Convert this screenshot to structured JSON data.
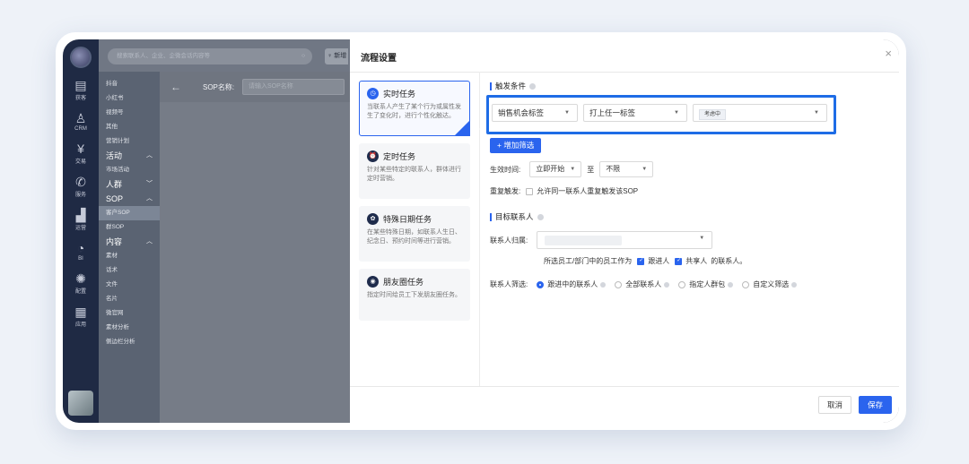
{
  "rail": {
    "items": [
      {
        "icon": "chat-icon",
        "label": "获客"
      },
      {
        "icon": "user-icon",
        "label": "CRM"
      },
      {
        "icon": "money-icon",
        "label": "交易"
      },
      {
        "icon": "phone-icon",
        "label": "服务"
      },
      {
        "icon": "bar-chart-icon",
        "label": "运营"
      },
      {
        "icon": "pie-icon",
        "label": "BI"
      },
      {
        "icon": "settings-icon",
        "label": "配置"
      },
      {
        "icon": "apps-icon",
        "label": "应用"
      }
    ]
  },
  "sidebar": {
    "items": [
      {
        "label": "抖音",
        "group": false
      },
      {
        "label": "小红书",
        "group": false
      },
      {
        "label": "视频号",
        "group": false
      },
      {
        "label": "其他",
        "group": false
      },
      {
        "label": "营销计划",
        "group": false
      },
      {
        "label": "活动",
        "group": true,
        "caret": "^"
      },
      {
        "label": "市场活动",
        "group": false
      },
      {
        "label": "人群",
        "group": true,
        "caret": "v"
      },
      {
        "label": "SOP",
        "group": true,
        "caret": "^"
      },
      {
        "label": "客户SOP",
        "group": false,
        "active": true
      },
      {
        "label": "群SOP",
        "group": false
      },
      {
        "label": "内容",
        "group": true,
        "caret": "^"
      },
      {
        "label": "素材",
        "group": false
      },
      {
        "label": "话术",
        "group": false
      },
      {
        "label": "文件",
        "group": false
      },
      {
        "label": "名片",
        "group": false
      },
      {
        "label": "微官网",
        "group": false
      },
      {
        "label": "素材分析",
        "group": false
      },
      {
        "label": "侧边栏分析",
        "group": false
      }
    ]
  },
  "topbar": {
    "search_placeholder": "搜索联系人、企业、企微会话内容等",
    "new_label": "新增"
  },
  "underlay": {
    "sop_label": "SOP名称:",
    "sop_placeholder": "请输入SOP名称"
  },
  "modal": {
    "title": "流程设置",
    "cards": [
      {
        "title": "实时任务",
        "desc": "当联系人产生了某个行为或属性发生了变化时，进行个性化触达。",
        "selected": true,
        "icon": "clock-icon"
      },
      {
        "title": "定时任务",
        "desc": "针对某些特定的联系人，群体进行定时营销。",
        "selected": false,
        "icon": "alarm-icon"
      },
      {
        "title": "特殊日期任务",
        "desc": "在某些特殊日期，如联系人生日、纪念日、预约时间等进行营销。",
        "selected": false,
        "icon": "gift-icon"
      },
      {
        "title": "朋友圈任务",
        "desc": "指定时间给员工下发朋友圈任务。",
        "selected": false,
        "icon": "moments-icon"
      }
    ],
    "trigger": {
      "section": "触发条件",
      "field1": "销售机会标签",
      "field2": "打上任一标签",
      "tag": "考虑中",
      "add_filter": "+ 增加筛选"
    },
    "effective": {
      "label": "生效时间:",
      "start": "立即开始",
      "to": "至",
      "end": "不限"
    },
    "repeat": {
      "label": "重复触发:",
      "option": "允许同一联系人重复触发该SOP"
    },
    "target": {
      "section": "目标联系人",
      "owner_label": "联系人归属:",
      "owner_note_prefix": "所选员工/部门中的员工作为",
      "owner_opt1": "跟进人",
      "owner_opt2": "共享人",
      "owner_note_suffix": "的联系人。",
      "filter_label": "联系人筛选:",
      "filters": [
        "跟进中的联系人",
        "全部联系人",
        "指定人群包",
        "自定义筛选"
      ]
    },
    "footer": {
      "cancel": "取消",
      "save": "保存"
    }
  }
}
